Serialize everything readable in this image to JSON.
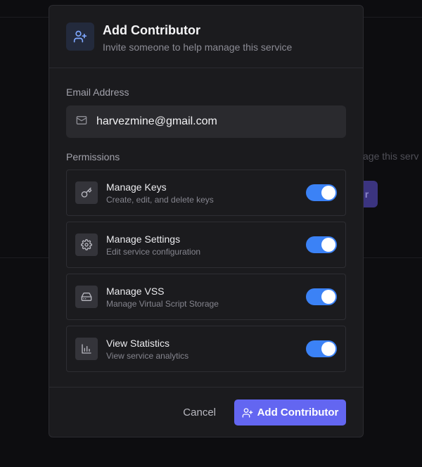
{
  "background": {
    "partial_text": "age this serv",
    "button_fragment": "r"
  },
  "modal": {
    "title": "Add Contributor",
    "subtitle": "Invite someone to help manage this service",
    "header_icon": "user-plus-icon",
    "email": {
      "label": "Email Address",
      "value": "harvezmine@gmail.com",
      "icon": "mail-icon"
    },
    "permissions": {
      "label": "Permissions",
      "items": [
        {
          "title": "Manage Keys",
          "description": "Create, edit, and delete keys",
          "icon": "key-icon",
          "enabled": true
        },
        {
          "title": "Manage Settings",
          "description": "Edit service configuration",
          "icon": "gear-icon",
          "enabled": true
        },
        {
          "title": "Manage VSS",
          "description": "Manage Virtual Script Storage",
          "icon": "hard-drive-icon",
          "enabled": true
        },
        {
          "title": "View Statistics",
          "description": "View service analytics",
          "icon": "bar-chart-icon",
          "enabled": true
        }
      ]
    },
    "footer": {
      "cancel_label": "Cancel",
      "submit_label": "Add Contributor"
    }
  },
  "colors": {
    "accent": "#6366f1",
    "toggle_on": "#3b82f6",
    "modal_bg": "#1b1b1e",
    "page_bg": "#0b0b0d"
  }
}
